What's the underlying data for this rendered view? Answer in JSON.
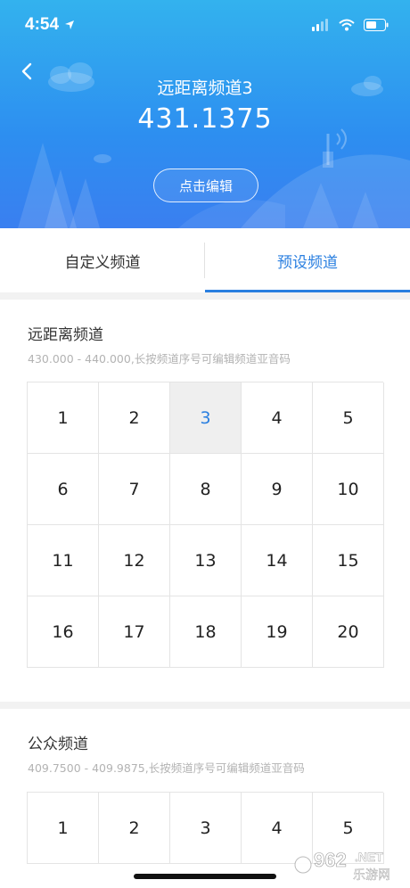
{
  "status_bar": {
    "time": "4:54"
  },
  "header": {
    "channel_name": "远距离频道3",
    "frequency": "431.1375",
    "edit_label": "点击编辑"
  },
  "tabs": [
    {
      "label": "自定义频道",
      "active": false
    },
    {
      "label": "预设频道",
      "active": true
    }
  ],
  "sections": [
    {
      "title": "远距离频道",
      "subtitle": "430.000 - 440.000,长按频道序号可编辑频道亚音码",
      "cells": [
        "1",
        "2",
        "3",
        "4",
        "5",
        "6",
        "7",
        "8",
        "9",
        "10",
        "11",
        "12",
        "13",
        "14",
        "15",
        "16",
        "17",
        "18",
        "19",
        "20"
      ],
      "selected": "3"
    },
    {
      "title": "公众频道",
      "subtitle": "409.7500 - 409.9875,长按频道序号可编辑频道亚音码",
      "cells": [
        "1",
        "2",
        "3",
        "4",
        "5"
      ],
      "selected": ""
    }
  ],
  "watermark": {
    "text": "962",
    "domain": ".NET",
    "site": "乐游网"
  },
  "colors": {
    "accent": "#2a7fe0",
    "header_top": "#33b2ee",
    "header_bottom": "#3a7ff0"
  }
}
